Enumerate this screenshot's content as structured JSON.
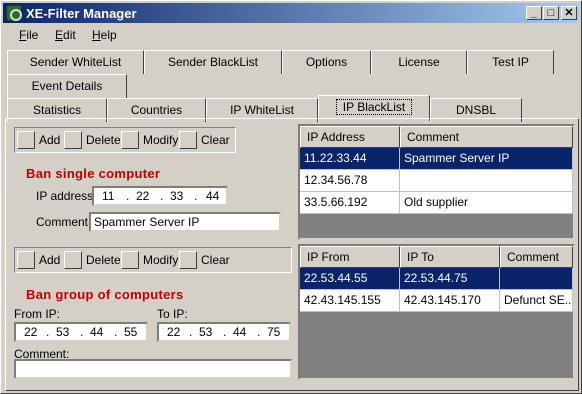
{
  "window": {
    "title": "XE-Filter Manager",
    "min": "_",
    "max": "□",
    "close": "✕"
  },
  "menu": [
    {
      "label": "File"
    },
    {
      "label": "Edit"
    },
    {
      "label": "Help"
    }
  ],
  "tabs_row1": [
    "Sender WhiteList",
    "Sender BlackList",
    "Options",
    "License",
    "Test IP"
  ],
  "tabs_row2": [
    "Event Details"
  ],
  "tabs_row3": [
    "Statistics",
    "Countries",
    "IP WhiteList",
    "IP BlackList",
    "DNSBL"
  ],
  "toolbar": {
    "add": "Add",
    "delete": "Delete",
    "modify": "Modify",
    "clear": "Clear"
  },
  "single": {
    "title": "Ban single computer",
    "ip_label": "IP address:",
    "ip": [
      "11",
      "22",
      "33",
      "44"
    ],
    "comment_label": "Comment:",
    "comment": "Spammer Server IP"
  },
  "group": {
    "title": "Ban group of computers",
    "from_label": "From IP:",
    "to_label": "To IP:",
    "from_ip": [
      "22",
      "53",
      "44",
      "55"
    ],
    "to_ip": [
      "22",
      "53",
      "44",
      "75"
    ],
    "comment_label": "Comment:",
    "comment": ""
  },
  "single_table": {
    "headers": [
      "IP Address",
      "Comment"
    ],
    "rows": [
      [
        "11.22.33.44",
        "Spammer Server IP"
      ],
      [
        "12.34.56.78",
        ""
      ],
      [
        "33.5.66.192",
        "Old supplier"
      ]
    ],
    "selected": 0
  },
  "range_table": {
    "headers": [
      "IP From",
      "IP To",
      "Comment"
    ],
    "rows": [
      [
        "22.53.44.55",
        "22.53.44.75",
        ""
      ],
      [
        "42.43.145.155",
        "42.43.145.170",
        "Defunct SE..."
      ]
    ],
    "selected": 0
  }
}
